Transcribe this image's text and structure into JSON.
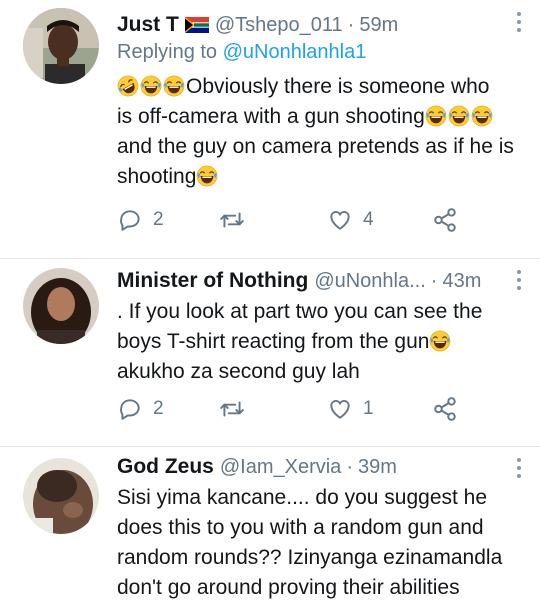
{
  "tweets": [
    {
      "name": "Just T",
      "handle": "@Tshepo_011",
      "time": "59m",
      "reply_prefix": "Replying to ",
      "reply_to": "@uNonhlanhla1",
      "line1": "Obviously there is someone who",
      "line2": "is off-camera with a gun shooting",
      "line3": "and the guy on camera pretends as if he is",
      "line4": "shooting",
      "replies": "2",
      "retweets": "",
      "likes": "4"
    },
    {
      "name": "Minister of Nothing",
      "handle": "@uNonhla...",
      "time": "43m",
      "line1": ". If you look at part two you can see the",
      "line2": "boys T-shirt reacting from the gun",
      "line3": "akukho za second guy lah",
      "replies": "2",
      "retweets": "",
      "likes": "1"
    },
    {
      "name": "God Zeus",
      "handle": "@Iam_Xervia",
      "time": "39m",
      "line1": "Sisi yima kancane.... do you suggest he",
      "line2": "does this to you with a random gun and",
      "line3": "random rounds?? Izinyanga ezinamandla",
      "line4": "don't go around proving their abilities"
    }
  ],
  "separator": "·",
  "icons": {
    "reply": "reply-icon",
    "retweet": "retweet-icon",
    "like": "heart-icon",
    "share": "share-icon",
    "laugh": "tears-of-joy-emoji",
    "rofl": "rolling-laughing-emoji",
    "flag": "south-africa-flag-emoji"
  },
  "colors": {
    "link": "#1da1f2",
    "secondary": "#657786",
    "text": "#14171a",
    "divider": "#e1e8ed"
  }
}
